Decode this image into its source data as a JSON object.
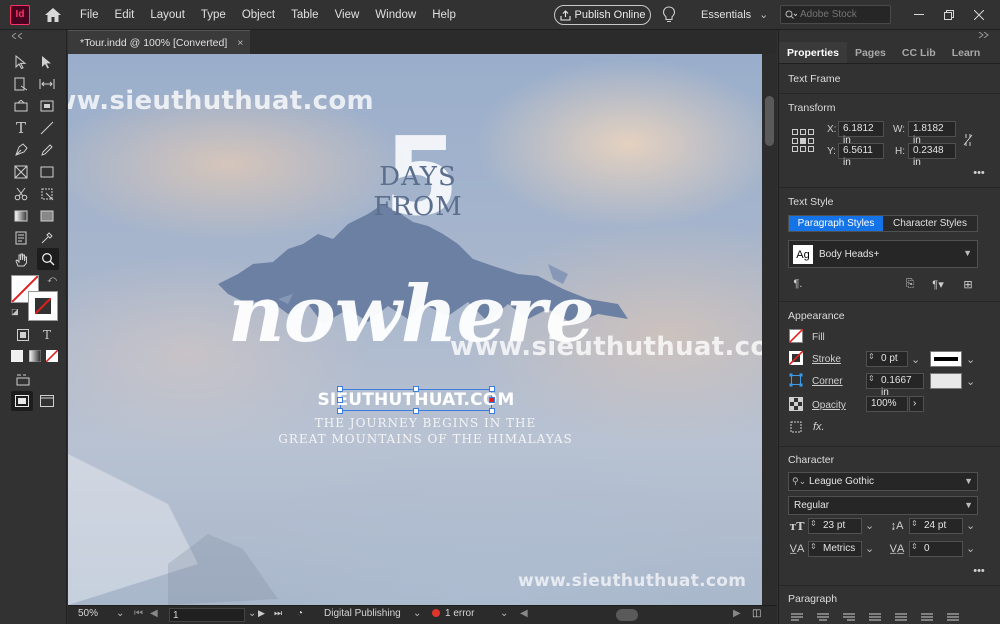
{
  "app": {
    "logo_text": "Id"
  },
  "menu": [
    "File",
    "Edit",
    "Layout",
    "Type",
    "Object",
    "Table",
    "View",
    "Window",
    "Help"
  ],
  "header": {
    "publish_label": "Publish Online",
    "workspace": "Essentials",
    "stock_placeholder": "Adobe Stock"
  },
  "document": {
    "tab_title": "*Tour.indd @ 100% [Converted]",
    "close_glyph": "×"
  },
  "canvas": {
    "watermark": "www.sieuthuthuat.com",
    "big_number": "5",
    "days_from": "DAYS FROM",
    "nowhere": "nowhere",
    "logo_text": "SIEUTHUTHUAT.COM",
    "tagline_1": "THE JOURNEY BEGINS IN THE",
    "tagline_2": "GREAT MOUNTAINS OF THE HIMALAYAS"
  },
  "statusbar": {
    "zoom": "50%",
    "page": "1",
    "preflight_profile": "Digital Publishing",
    "errors": "1 error"
  },
  "panel": {
    "tabs": [
      "Properties",
      "Pages",
      "CC Lib",
      "Learn"
    ],
    "object_type": "Text Frame",
    "transform": {
      "title": "Transform",
      "x_label": "X:",
      "x": "6.1812 in",
      "y_label": "Y:",
      "y": "6.5611 in",
      "w_label": "W:",
      "w": "1.8182 in",
      "h_label": "H:",
      "h": "0.2348 in"
    },
    "text_style": {
      "title": "Text Style",
      "paragraph_tab": "Paragraph Styles",
      "character_tab": "Character Styles",
      "style_preview": "Ag",
      "style_name": "Body Heads+"
    },
    "appearance": {
      "title": "Appearance",
      "fill_label": "Fill",
      "stroke_label": "Stroke",
      "stroke_weight": "0 pt",
      "corner_label": "Corner",
      "corner_value": "0.1667 in",
      "opacity_label": "Opacity",
      "opacity_value": "100%",
      "fx_label": "fx."
    },
    "character": {
      "title": "Character",
      "font": "League Gothic",
      "style": "Regular",
      "size": "23 pt",
      "leading": "24 pt",
      "kerning": "Metrics",
      "tracking": "0"
    },
    "paragraph": {
      "title": "Paragraph"
    }
  }
}
